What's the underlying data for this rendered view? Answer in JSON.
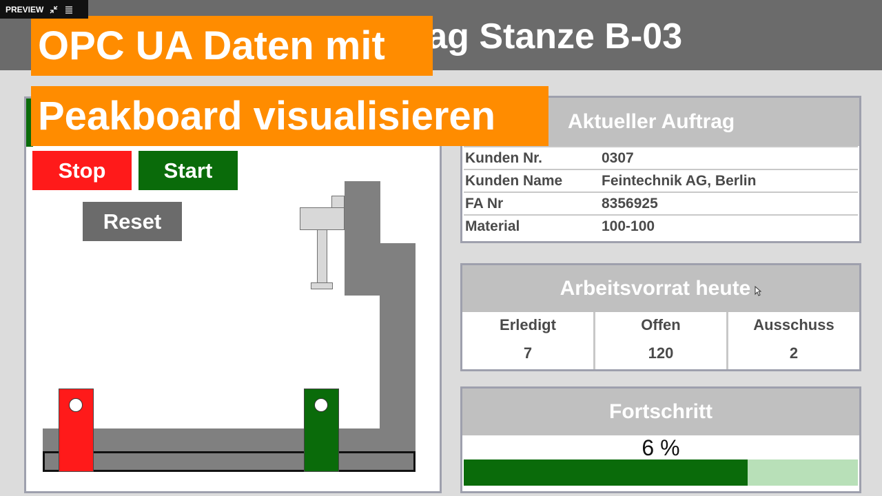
{
  "preview": {
    "label": "PREVIEW"
  },
  "header": {
    "title_visible": "rag Stanze B-03"
  },
  "banner": {
    "line1": "OPC UA Daten mit",
    "line2": "Peakboard visualisieren",
    "color": "#ff8c00"
  },
  "machine": {
    "stop_label": "Stop",
    "start_label": "Start",
    "reset_label": "Reset",
    "colors": {
      "stop": "#ff1a1a",
      "start": "#0a6b0a",
      "reset": "#6b6b6b"
    }
  },
  "order": {
    "title": "Aktueller Auftrag",
    "rows": [
      {
        "key": "Kunden Nr.",
        "value": "0307"
      },
      {
        "key": "Kunden Name",
        "value": "Feintechnik AG, Berlin"
      },
      {
        "key": "FA Nr",
        "value": "8356925"
      },
      {
        "key": "Material",
        "value": "100-100"
      }
    ]
  },
  "stock": {
    "title": "Arbeitsvorrat heute",
    "columns": [
      {
        "label": "Erledigt",
        "value": "7"
      },
      {
        "label": "Offen",
        "value": "120"
      },
      {
        "label": "Ausschuss",
        "value": "2"
      }
    ]
  },
  "progress": {
    "title": "Fortschritt",
    "percent_label": "6 %",
    "bar_fill_fraction": 0.72,
    "colors": {
      "fill": "#0a6b0a",
      "track": "#b8e0b8"
    }
  }
}
